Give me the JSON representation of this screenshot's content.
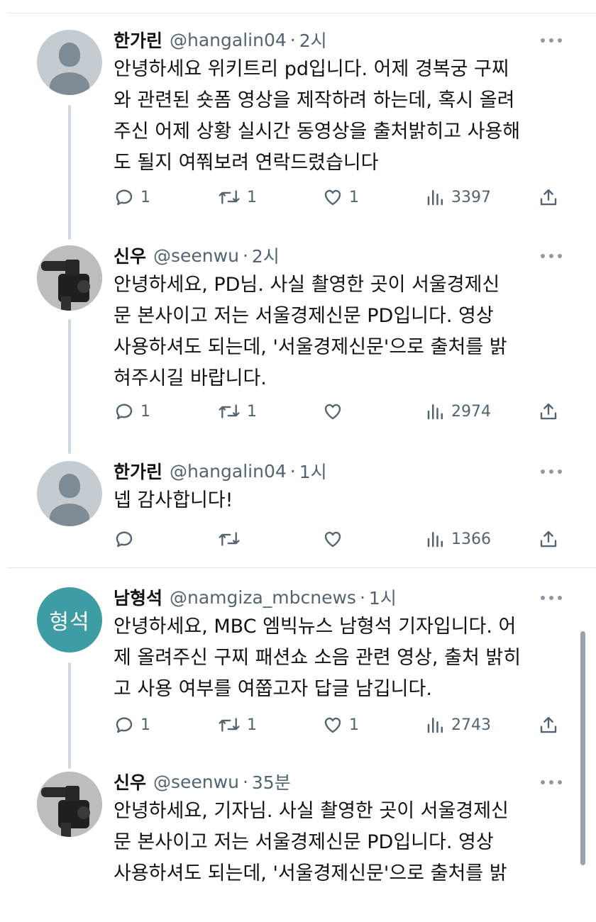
{
  "tweets": [
    {
      "name": "한가린",
      "handle": "@hangalin04",
      "time": "2시",
      "text": "안녕하세요 위키트리 pd입니다. 어제 경복궁 구찌\n와 관련된 숏폼 영상을 제작하려 하는데, 혹시 올려\n주신 어제 상황 실시간 동영상을 출처밝히고 사용해\n도 될지 여쭤보려 연락드렸습니다",
      "replies": "1",
      "retweets": "1",
      "likes": "1",
      "views": "3397"
    },
    {
      "name": "신우",
      "handle": "@seenwu",
      "time": "2시",
      "text": "안녕하세요, PD님. 사실 촬영한 곳이 서울경제신\n문 본사이고 저는 서울경제신문 PD입니다. 영상\n사용하셔도 되는데, '서울경제신문'으로 출처를 밝\n혀주시길 바랍니다.",
      "replies": "1",
      "retweets": "1",
      "likes": "",
      "views": "2974"
    },
    {
      "name": "한가린",
      "handle": "@hangalin04",
      "time": "1시",
      "text": "넵 감사합니다!",
      "replies": "",
      "retweets": "",
      "likes": "",
      "views": "1366"
    },
    {
      "name": "남형석",
      "handle": "@namgiza_mbcnews",
      "time": "1시",
      "avatar_text": "형석",
      "text": "안녕하세요, MBC 엠빅뉴스 남형석 기자입니다. 어\n제 올려주신 구찌 패션쇼 소음 관련 영상, 출처 밝히\n고 사용 여부를 여쭙고자 답글 남깁니다.",
      "replies": "1",
      "retweets": "1",
      "likes": "1",
      "views": "2743"
    },
    {
      "name": "신우",
      "handle": "@seenwu",
      "time": "35분",
      "text": "안녕하세요, 기자님. 사실 촬영한 곳이 서울경제신\n문 본사이고 저는 서울경제신문 PD입니다. 영상\n사용하셔도 되는데, '서울경제신문'으로 출처를 밝"
    }
  ],
  "colors": {
    "text": "#0f1419",
    "muted": "#536471",
    "thread_line": "#cfd9de",
    "avatar_teal": "#3e9ca4"
  },
  "icons": [
    "reply-icon",
    "retweet-icon",
    "like-icon",
    "views-icon",
    "share-icon",
    "more-icon"
  ]
}
